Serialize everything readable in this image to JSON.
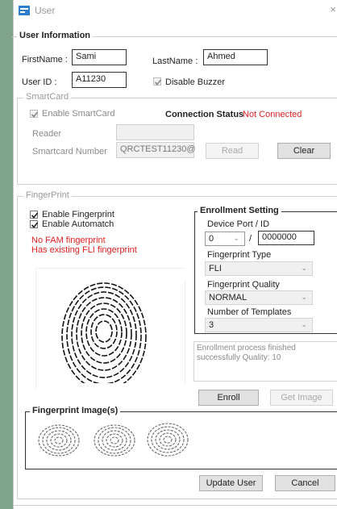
{
  "window": {
    "title": "User"
  },
  "user_info": {
    "legend": "User Information",
    "firstname_label": "FirstName :",
    "firstname_value": "Sami",
    "lastname_label": "LastName :",
    "lastname_value": "Ahmed",
    "userid_label": "User ID :",
    "userid_value": "A11230",
    "disable_buzzer_label": "Disable Buzzer",
    "disable_buzzer_checked": true
  },
  "smartcard": {
    "legend": "SmartCard",
    "enable_label": "Enable SmartCard",
    "enable_checked": true,
    "connection_status_label": "Connection Status",
    "connection_status_value": "Not Connected",
    "reader_label": "Reader",
    "reader_value": "",
    "number_label": "Smartcard Number",
    "number_value": "QRCTEST11230@",
    "read_button": "Read",
    "clear_button": "Clear"
  },
  "fingerprint": {
    "legend": "FingerPrint",
    "enable_label": "Enable Fingerprint",
    "enable_checked": true,
    "automatch_label": "Enable Automatch",
    "automatch_checked": true,
    "msg_no_fam": "No FAM fingerprint",
    "msg_existing": "Has existing FLI fingerprint",
    "enrollment": {
      "legend": "Enrollment Setting",
      "device_label": "Device Port / ID",
      "port_value": "0",
      "separator": "/",
      "id_value": "0000000",
      "type_label": "Fingerprint Type",
      "type_value": "FLI",
      "quality_label": "Fingerprint Quality",
      "quality_value": "NORMAL",
      "templates_label": "Number of Templates",
      "templates_value": "3"
    },
    "status_message": "Enrollment process finished successfully Quality: 10",
    "enroll_button": "Enroll",
    "get_image_button": "Get Image",
    "images_legend": "Fingerprint Image(s)"
  },
  "actions": {
    "update_button": "Update User",
    "cancel_button": "Cancel"
  },
  "icons": {
    "app": "user-app-icon",
    "close": "close-icon",
    "check": "checkmark-icon",
    "dropdown": "chevron-down-icon"
  },
  "colors": {
    "error_text": "#e02020",
    "background": "#7fa38c"
  }
}
